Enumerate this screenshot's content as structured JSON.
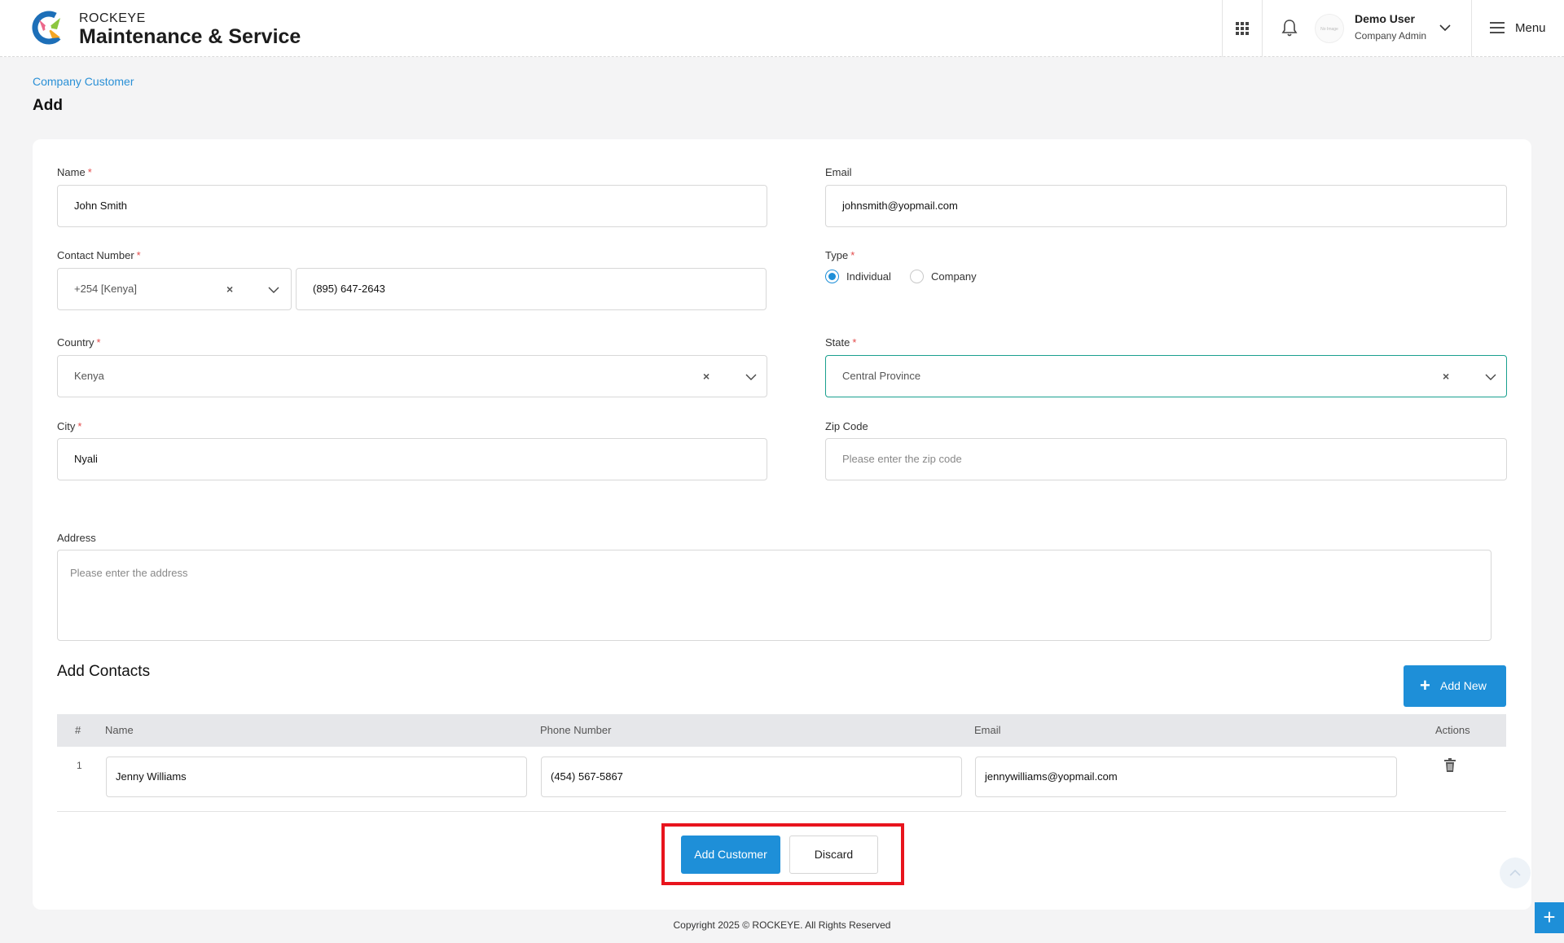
{
  "header": {
    "brand_top": "ROCKEYE",
    "brand_main": "Maintenance & Service",
    "avatar_text": "No Image",
    "user_name": "Demo User",
    "user_role": "Company Admin",
    "menu_label": "Menu",
    "icons": [
      "apps-grid-icon",
      "bell-icon",
      "chevron-down-icon",
      "hamburger-icon"
    ]
  },
  "breadcrumb": "Company Customer",
  "page_title": "Add",
  "form": {
    "name": {
      "label": "Name",
      "required": "*",
      "value": "John Smith"
    },
    "email": {
      "label": "Email",
      "value": "johnsmith@yopmail.com"
    },
    "contact": {
      "label": "Contact Number",
      "required": "*",
      "country_code": "+254 [Kenya]",
      "value": "(895) 647-2643"
    },
    "type": {
      "label": "Type",
      "required": "*",
      "options": [
        "Individual",
        "Company"
      ],
      "selected": "Individual"
    },
    "country": {
      "label": "Country",
      "required": "*",
      "value": "Kenya"
    },
    "state": {
      "label": "State",
      "required": "*",
      "value": "Central Province"
    },
    "city": {
      "label": "City",
      "required": "*",
      "value": "Nyali"
    },
    "zip": {
      "label": "Zip Code",
      "placeholder": "Please enter the zip code"
    },
    "address": {
      "label": "Address",
      "placeholder": "Please enter the address"
    },
    "clear_glyph": "×"
  },
  "contacts": {
    "title": "Add Contacts",
    "add_new_label": "Add New",
    "add_new_glyph": "+",
    "columns": [
      "#",
      "Name",
      "Phone Number",
      "Email",
      "Actions"
    ],
    "rows": [
      {
        "num": "1",
        "name": "Jenny Williams",
        "phone": "(454) 567-5867",
        "email": "jennywilliams@yopmail.com"
      }
    ]
  },
  "actions": {
    "submit_label": "Add Customer",
    "discard_label": "Discard",
    "highlight_color": "#e8141d"
  },
  "fab_glyph": "+",
  "footer": "Copyright 2025 © ROCKEYE. All Rights Reserved",
  "colors": {
    "primary": "#1e8fd8",
    "link": "#2a90d6",
    "focus_border": "#1aa08f",
    "required": "#e34b4b"
  }
}
